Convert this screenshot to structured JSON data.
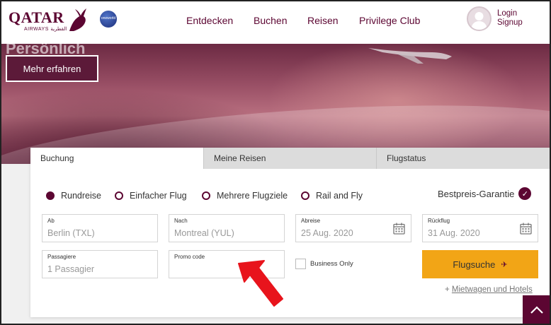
{
  "brand": {
    "name": "QATAR",
    "sub": "AIRWAYS القطرية",
    "alliance": "oneworld"
  },
  "nav": {
    "items": [
      "Entdecken",
      "Buchen",
      "Reisen",
      "Privilege Club"
    ],
    "login": "Login",
    "signup": "Signup"
  },
  "hero": {
    "cut_text": "Persönlich",
    "button": "Mehr erfahren"
  },
  "booking": {
    "tabs": [
      "Buchung",
      "Meine Reisen",
      "Flugstatus"
    ],
    "trip_types": [
      "Rundreise",
      "Einfacher Flug",
      "Mehrere Flugziele",
      "Rail and Fly"
    ],
    "selected_trip": "Rundreise",
    "guarantee": "Bestpreis-Garantie",
    "fields": {
      "from": {
        "label": "Ab",
        "value": "Berlin (TXL)"
      },
      "to": {
        "label": "Nach",
        "value": "Montreal (YUL)"
      },
      "depart": {
        "label": "Abreise",
        "value": "25 Aug. 2020"
      },
      "return": {
        "label": "Rückflug",
        "value": "31 Aug. 2020"
      },
      "pax": {
        "label": "Passagiere",
        "value": "1 Passagier"
      },
      "promo": {
        "label": "Promo code",
        "value": ""
      }
    },
    "business_only": "Business Only",
    "search_button": "Flugsuche",
    "extra_prefix": "+ ",
    "extra_link": "Mietwagen und Hotels"
  },
  "colors": {
    "brand": "#5c0632",
    "search": "#f2a516"
  }
}
